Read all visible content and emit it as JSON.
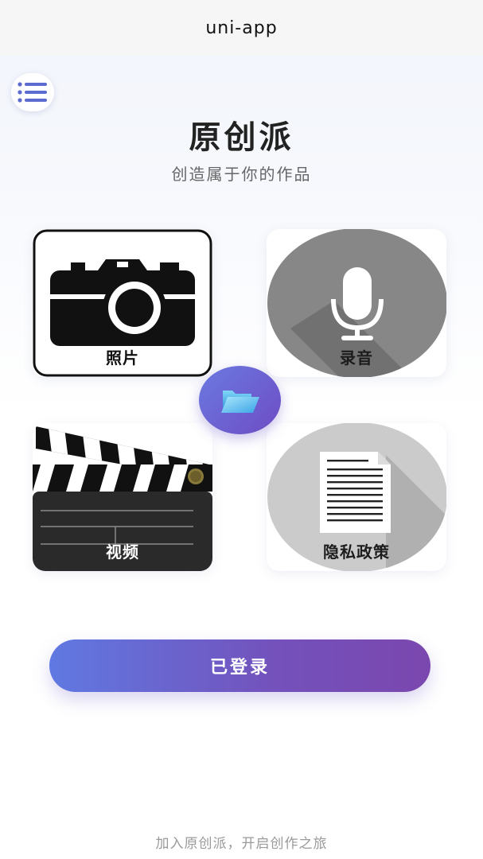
{
  "nav": {
    "title": "uni-app"
  },
  "menu": {
    "icon": "list-menu-icon"
  },
  "header": {
    "title": "原创派",
    "subtitle": "创造属于你的作品"
  },
  "cards": [
    {
      "label": "照片",
      "icon": "camera-icon"
    },
    {
      "label": "录音",
      "icon": "microphone-icon"
    },
    {
      "label": "视频",
      "icon": "clapperboard-icon"
    },
    {
      "label": "隐私政策",
      "icon": "document-icon"
    }
  ],
  "center_button": {
    "icon": "folder-open-icon"
  },
  "login_button": {
    "label": "已登录"
  },
  "footer": {
    "text": "加入原创派，开启创作之旅"
  },
  "colors": {
    "accent_start": "#6079e2",
    "accent_end": "#7a47ae",
    "title": "#222222",
    "subtitle": "#666666"
  }
}
